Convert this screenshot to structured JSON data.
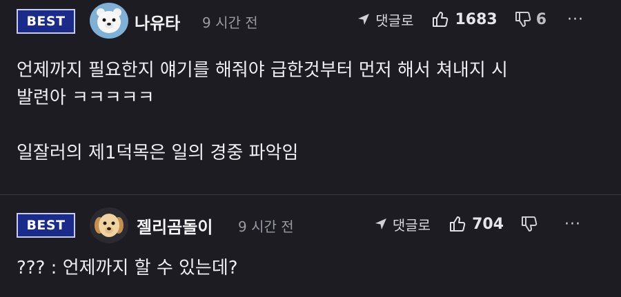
{
  "comments": [
    {
      "badge": "BEST",
      "nickname": "나유타",
      "time": "9 시간 전",
      "reply_label": "댓글로",
      "likes": "1683",
      "dislikes": "6",
      "more": "···",
      "body": [
        "언제까지 필요한지 얘기를 해줘야 급한것부터 먼저 해서 쳐내지 시",
        "발련아 ㅋㅋㅋㅋㅋ",
        "",
        "일잘러의 제1덕목은 일의 경중 파악임"
      ]
    },
    {
      "badge": "BEST",
      "nickname": "젤리곰돌이",
      "time": "9 시간 전",
      "reply_label": "댓글로",
      "likes": "704",
      "more": "···",
      "body": [
        "??? : 언제까지 할 수 있는데?"
      ]
    }
  ],
  "colors": {
    "background": "#1c1c22",
    "badge_bg": "#1a2b8c",
    "badge_border": "#c9cdf0",
    "muted": "#9a9aa4"
  }
}
